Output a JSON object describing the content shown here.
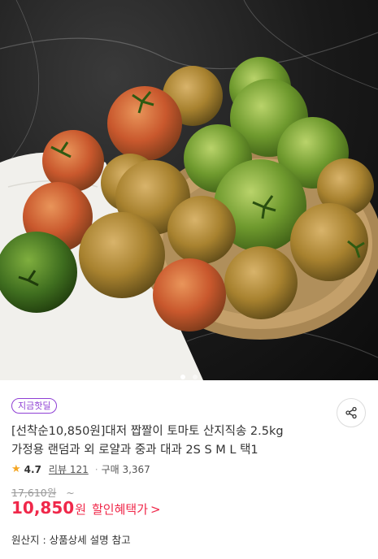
{
  "hero": {
    "image_label": "tomato product photo",
    "pager": {
      "total": 2,
      "active": 1
    }
  },
  "badge": {
    "label": "지금핫딜",
    "color": "#8f3fd4"
  },
  "share": {
    "icon": "share-icon"
  },
  "product": {
    "title_line1": "[선착순10,850원]대저 짭짤이 토마토 산지직송 2.5kg",
    "title_line2": "가정용 랜덤과 외 로얄과 중과 대과 2S S M L 택1"
  },
  "meta": {
    "star_icon": "star-icon",
    "rating": "4.7",
    "review_label": "리뷰 121",
    "separator": "·",
    "purchase_label": "구매 3,367"
  },
  "price": {
    "original": "17,610원",
    "tilde": "~",
    "sale": "10,850",
    "sale_unit": "원",
    "benefit_label": "할인혜택가",
    "benefit_chevron": ">",
    "color": "#f0284a"
  },
  "origin": {
    "text": "원산지 : 상품상세 설명 참고"
  }
}
